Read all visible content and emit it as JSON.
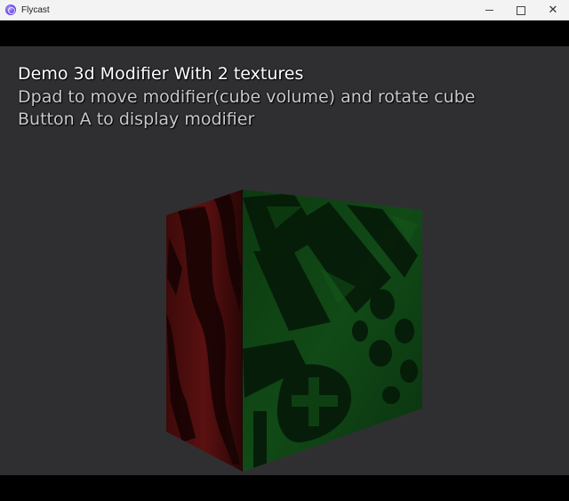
{
  "window": {
    "title": "Flycast",
    "icon": "flycast-icon",
    "controls": {
      "close_glyph": "✕"
    }
  },
  "scene": {
    "line1": "Demo 3d Modifier With 2 textures",
    "line2": "Dpad to move modifier(cube volume) and rotate cube",
    "line3": "Button A to display modifier"
  },
  "colors": {
    "viewport_bg": "#2f2f32",
    "letterbox": "#000000",
    "cube_left_face": "#5a0f0f",
    "cube_right_face": "#0f4a14"
  }
}
